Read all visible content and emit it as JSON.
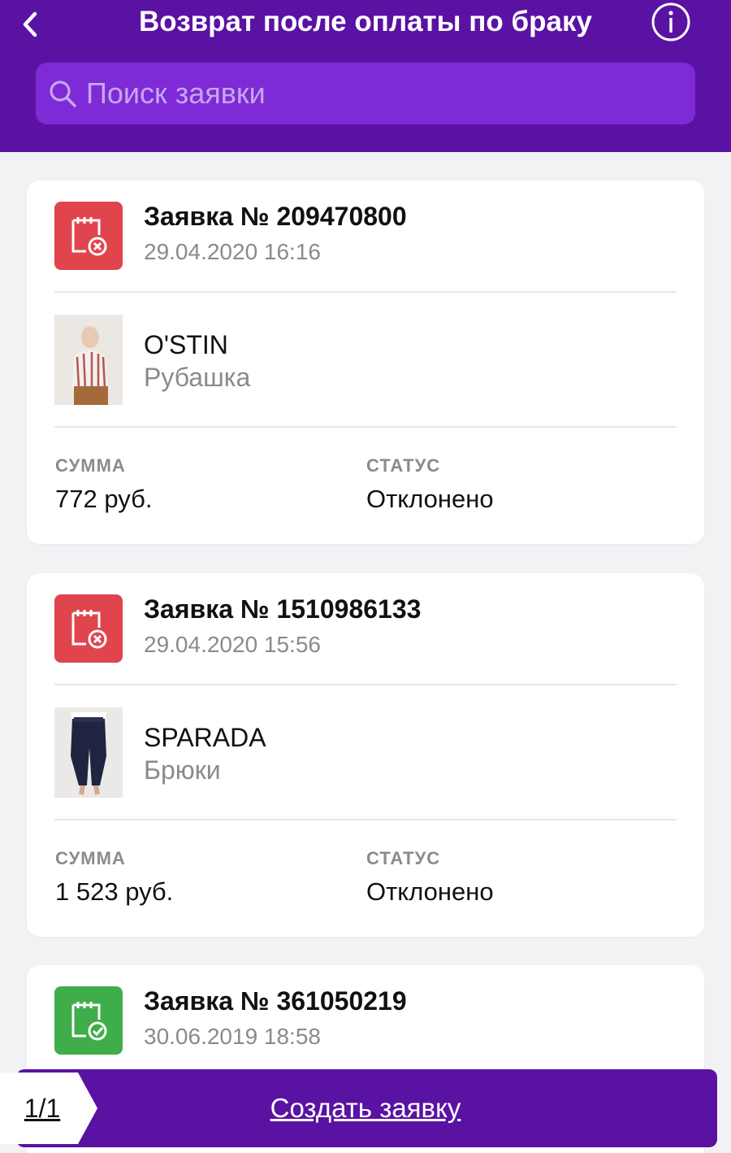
{
  "header": {
    "title": "Возврат после оплаты по браку",
    "back_icon": "chevron-left-icon",
    "info_icon": "info-icon"
  },
  "search": {
    "placeholder": "Поиск заявки",
    "value": ""
  },
  "labels": {
    "amount": "СУММА",
    "status": "СТАТУС"
  },
  "requests": [
    {
      "title": "Заявка № 209470800",
      "date": "29.04.2020 16:16",
      "icon": "request-rejected-icon",
      "icon_color": "#e0454d",
      "brand": "O'STIN",
      "product": "Рубашка",
      "amount": "772 руб.",
      "status": "Отклонено"
    },
    {
      "title": "Заявка № 1510986133",
      "date": "29.04.2020 15:56",
      "icon": "request-rejected-icon",
      "icon_color": "#e0454d",
      "brand": "SPARADA",
      "product": "Брюки",
      "amount": "1 523 руб.",
      "status": "Отклонено"
    },
    {
      "title": "Заявка № 361050219",
      "date": "30.06.2019 18:58",
      "icon": "request-approved-icon",
      "icon_color": "#3fad4a"
    }
  ],
  "bottom": {
    "counter": "1/1",
    "create_label": "Создать заявку"
  },
  "colors": {
    "header_bg": "#5a12a3",
    "search_bg": "#7e2ad6",
    "rejected": "#e0454d",
    "approved": "#3fad4a",
    "page_bg": "#f2f2f5"
  }
}
